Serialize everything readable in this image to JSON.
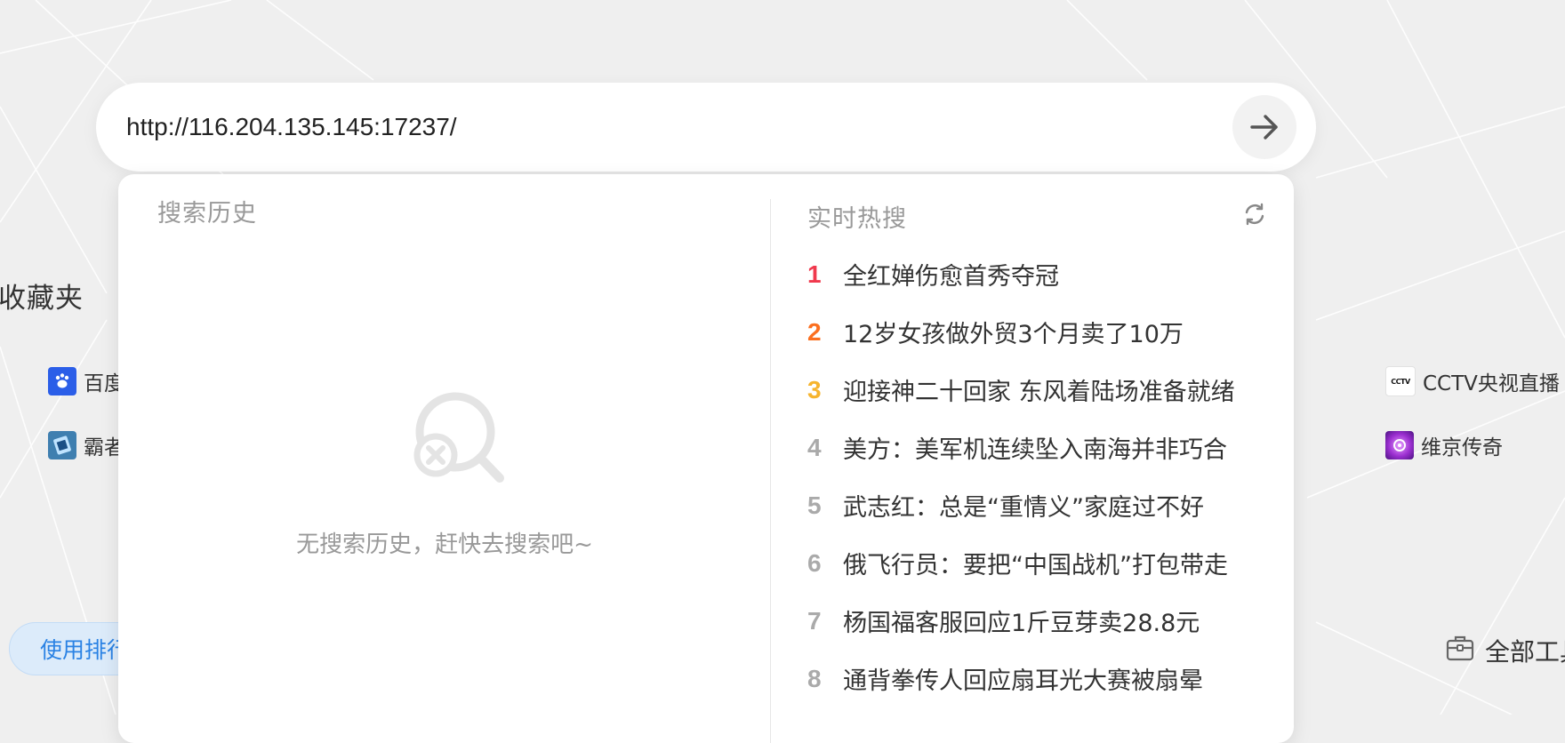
{
  "search": {
    "value": "http://116.204.135.145:17237/",
    "go_icon": "arrow-right-icon"
  },
  "history": {
    "title": "搜索历史",
    "empty_text": "无搜索历史，赶快去搜索吧~",
    "empty_icon": "no-search-icon"
  },
  "hot": {
    "title": "实时热搜",
    "refresh_icon": "refresh-icon",
    "rank_colors": [
      "#f0394d",
      "#fb6f1f",
      "#f6b42e",
      "#aaaaaa"
    ],
    "items": [
      {
        "rank": "1",
        "text": "全红婵伤愈首秀夺冠"
      },
      {
        "rank": "2",
        "text": "12岁女孩做外贸3个月卖了10万"
      },
      {
        "rank": "3",
        "text": "迎接神二十回家 东风着陆场准备就绪"
      },
      {
        "rank": "4",
        "text": "美方：美军机连续坠入南海并非巧合"
      },
      {
        "rank": "5",
        "text": "武志红：总是“重情义”家庭过不好"
      },
      {
        "rank": "6",
        "text": "俄飞行员：要把“中国战机”打包带走"
      },
      {
        "rank": "7",
        "text": "杨国福客服回应1斤豆芽卖28.8元"
      },
      {
        "rank": "8",
        "text": "通背拳传人回应扇耳光大赛被扇晕"
      }
    ]
  },
  "background": {
    "favorites_heading": "收藏夹",
    "sites": [
      {
        "label": "百度",
        "icon": "baidu-icon"
      },
      {
        "label": "霸者",
        "icon": "game-icon"
      },
      {
        "label": "CCTV央视直播",
        "icon": "cctv-icon"
      },
      {
        "label": "维京传奇",
        "icon": "vikings-icon"
      }
    ],
    "usage_ranking": "使用排行",
    "all_tools": "全部工具",
    "all_tools_icon": "toolbox-icon"
  }
}
